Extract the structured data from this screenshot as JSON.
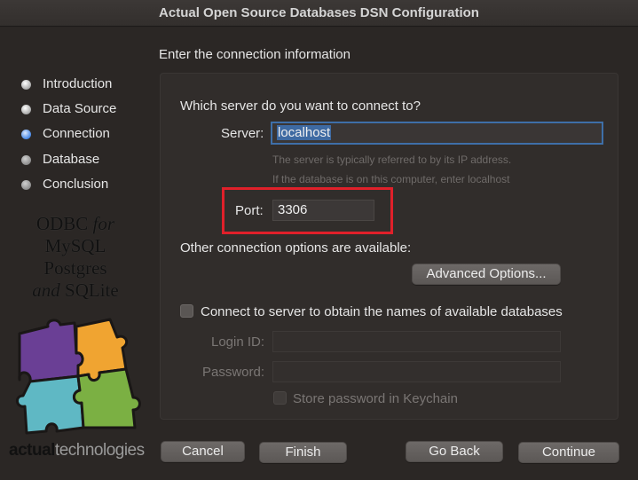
{
  "window": {
    "title": "Actual Open Source Databases DSN Configuration"
  },
  "steps": [
    {
      "label": "Introduction",
      "state": "done"
    },
    {
      "label": "Data Source",
      "state": "done"
    },
    {
      "label": "Connection",
      "state": "active"
    },
    {
      "label": "Database",
      "state": "pending"
    },
    {
      "label": "Conclusion",
      "state": "pending"
    }
  ],
  "branding": {
    "line1_a": "ODBC",
    "line1_b": "for",
    "line2": "MySQL",
    "line3": "Postgres",
    "line4_a": "and",
    "line4_b": "SQLite",
    "logo_actual": "actual",
    "logo_technologies": "technologies",
    "puzzle_colors": [
      "#6a3f95",
      "#f0a431",
      "#5fb8c4",
      "#7bb043"
    ]
  },
  "section_title": "Enter the connection information",
  "server": {
    "question": "Which server do you want to connect to?",
    "label": "Server:",
    "value": "localhost",
    "hint1": "The server is typically referred to by its IP address.",
    "hint2": "If the database is on this computer, enter localhost"
  },
  "port": {
    "label": "Port:",
    "value": "3306"
  },
  "options": {
    "text": "Other connection options are available:",
    "advanced_button": "Advanced Options..."
  },
  "connect_checkbox": {
    "label": "Connect to server to obtain the names of available databases",
    "checked": false
  },
  "login": {
    "label": "Login ID:",
    "value": ""
  },
  "password": {
    "label": "Password:",
    "value": ""
  },
  "keychain": {
    "label": "Store password in Keychain",
    "checked": false
  },
  "buttons": {
    "cancel": "Cancel",
    "finish": "Finish",
    "go_back": "Go Back",
    "continue": "Continue"
  },
  "colors": {
    "highlight": "#e0202a",
    "active_step": "#4f8ee8"
  }
}
